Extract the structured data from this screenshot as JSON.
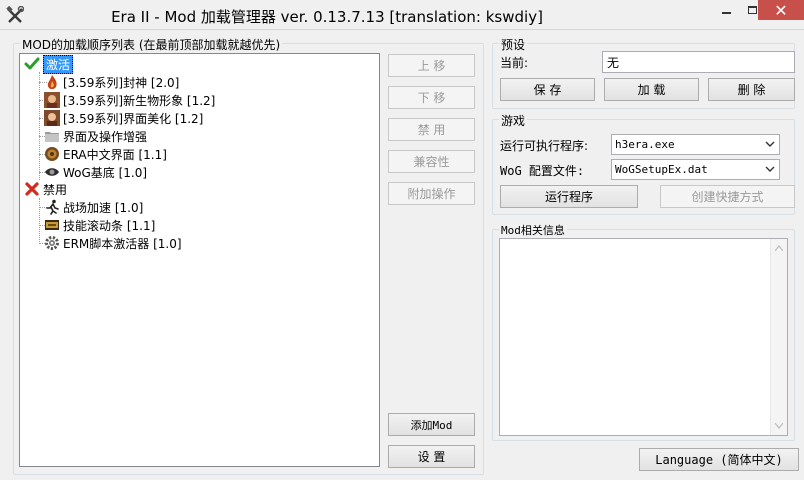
{
  "window": {
    "title": "Era II - Mod 加载管理器 ver. 0.13.7.13 [translation: kswdiy]",
    "close_glyph": "✕"
  },
  "modlist": {
    "label": "MOD的加载顺序列表 (在最前顶部加载就越优先)",
    "active_label": "激活",
    "disabled_label": "禁用",
    "active_items": [
      "[3.59系列]封神 [2.0]",
      "[3.59系列]新生物形象 [1.2]",
      "[3.59系列]界面美化 [1.2]",
      "界面及操作增强",
      "ERA中文界面 [1.1]",
      "WoG基底 [1.0]"
    ],
    "disabled_items": [
      "战场加速 [1.0]",
      "技能滚动条 [1.1]",
      "ERM脚本激活器 [1.0]"
    ]
  },
  "actions": {
    "move_up": "上 移",
    "move_down": "下 移",
    "disable": "禁 用",
    "compat": "兼容性",
    "extra_ops": "附加操作",
    "add_mod": "添加Mod",
    "settings": "设 置"
  },
  "preset": {
    "group_label": "预设",
    "current_label": "当前:",
    "current_value": "无",
    "save": "保 存",
    "load": "加 载",
    "delete": "删 除"
  },
  "game": {
    "group_label": "游戏",
    "exe_label": "运行可执行程序:",
    "exe_value": "h3era.exe",
    "config_label": "WoG 配置文件:",
    "config_value": "WoGSetupEx.dat",
    "run": "运行程序",
    "shortcut": "创建快捷方式"
  },
  "info": {
    "group_label": "Mod相关信息",
    "content": ""
  },
  "language_button": "Language (简体中文)",
  "icons": {
    "app": "crossed-tools-icon",
    "active": "green-check-icon",
    "disabled": "red-x-icon"
  },
  "colors": {
    "selection": "#3399ff",
    "close_button": "#c7504b",
    "check_green": "#2a9d2a",
    "x_red": "#d12a1e"
  }
}
